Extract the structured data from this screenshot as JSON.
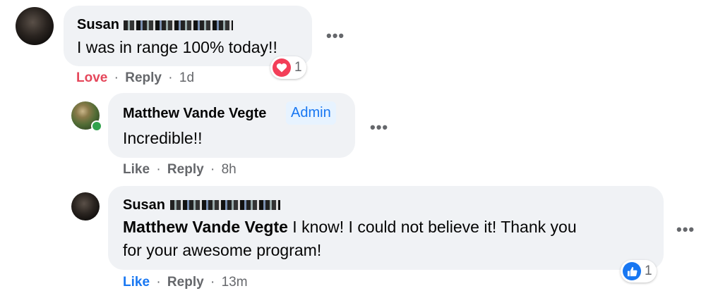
{
  "comments": [
    {
      "author_first": "Susan",
      "text": "I was in range 100% today!!",
      "actions": [
        "Love",
        "Reply"
      ],
      "time": "1d",
      "reaction": {
        "icon": "love-heart-icon",
        "count": "1"
      }
    },
    {
      "author": "Matthew Vande Vegte",
      "badge": "Admin",
      "text": "Incredible!!",
      "actions": [
        "Like",
        "Reply"
      ],
      "time": "8h"
    },
    {
      "author_first": "Susan",
      "mention": "Matthew Vande Vegte",
      "text": "I know! I could not believe it! Thank you",
      "text2": "for your awesome program!",
      "actions": [
        "Like",
        "Reply"
      ],
      "time": "13m",
      "reaction": {
        "icon": "thumbs-up-icon",
        "count": "1"
      }
    }
  ],
  "ui": {
    "separator": "·",
    "more_glyph": "•••"
  },
  "colors": {
    "love": "#e5475b",
    "like_blue": "#1877f2",
    "bubble": "#f0f2f5",
    "meta": "#65676b"
  }
}
